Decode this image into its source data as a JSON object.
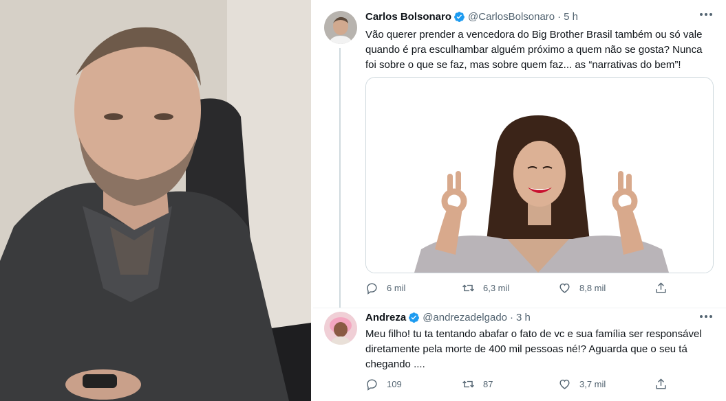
{
  "tweets": [
    {
      "name": "Carlos Bolsonaro",
      "handle": "@CarlosBolsonaro",
      "dot": "·",
      "time": "5 h",
      "text": "Vão querer prender a vencedora do Big Brother Brasil também ou só vale quando é pra esculhambar alguém próximo a quem não se gosta? Nunca foi sobre o que se faz, mas sobre quem faz... as “narrativas do bem”!",
      "replies": "6 mil",
      "retweets": "6,3 mil",
      "likes": "8,8 mil"
    },
    {
      "name": "Andreza",
      "handle": "@andrezadelgado",
      "dot": "·",
      "time": "3 h",
      "text": "Meu filho! tu ta tentando abafar o fato de vc e sua família ser responsável diretamente pela morte de 400 mil pessoas né!? Aguarda que o seu tá chegando ....",
      "replies": "109",
      "retweets": "87",
      "likes": "3,7 mil"
    }
  ],
  "icons": {
    "verified": "verified-badge-icon",
    "reply": "reply-icon",
    "retweet": "retweet-icon",
    "like": "heart-icon",
    "share": "share-icon",
    "more": "more-icon"
  },
  "colors": {
    "verified": "#1d9bf0",
    "muted": "#536471",
    "text": "#0f1419",
    "lipstick": "#c8102e"
  }
}
